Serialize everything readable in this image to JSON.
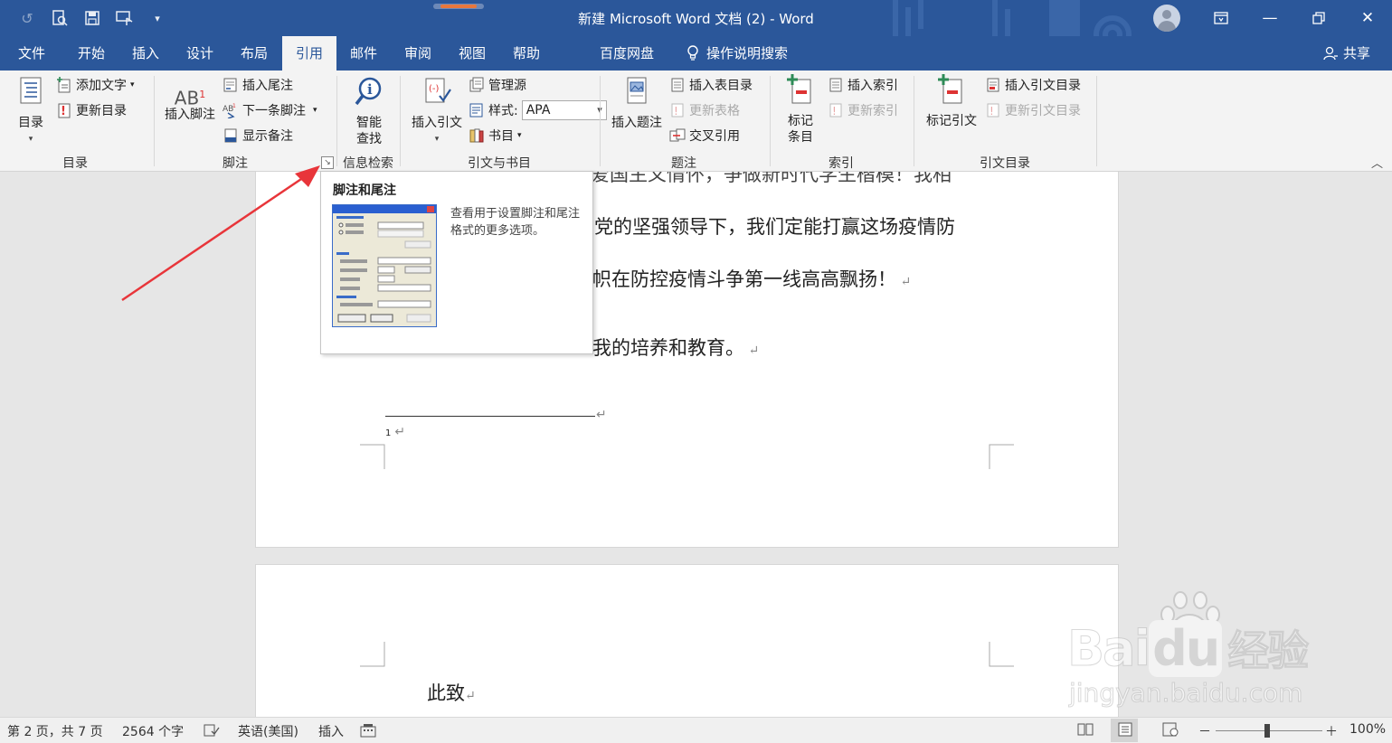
{
  "titlebar": {
    "title": "新建 Microsoft Word 文档 (2)  -  Word"
  },
  "tabs": [
    {
      "label": "文件"
    },
    {
      "label": "开始"
    },
    {
      "label": "插入"
    },
    {
      "label": "设计"
    },
    {
      "label": "布局"
    },
    {
      "label": "引用",
      "active": true
    },
    {
      "label": "邮件"
    },
    {
      "label": "审阅"
    },
    {
      "label": "视图"
    },
    {
      "label": "帮助"
    },
    {
      "label": "百度网盘"
    },
    {
      "label": "操作说明搜索"
    }
  ],
  "share_label": "共享",
  "ribbon": {
    "toc": {
      "big_label": "目录",
      "add_text": "添加文字",
      "update_toc": "更新目录",
      "group": "目录"
    },
    "footnotes": {
      "insert_footnote": "插入脚注",
      "insert_endnote": "插入尾注",
      "next_footnote": "下一条脚注",
      "show_notes": "显示备注",
      "group": "脚注"
    },
    "research": {
      "smart_lookup_1": "智能",
      "smart_lookup_2": "查找",
      "group": "信息检索"
    },
    "citations": {
      "insert_citation": "插入引文",
      "manage_sources": "管理源",
      "style_label": "样式:",
      "style_value": "APA",
      "bibliography": "书目",
      "group": "引文与书目"
    },
    "captions": {
      "insert_caption": "插入题注",
      "insert_tof": "插入表目录",
      "update_table": "更新表格",
      "cross_ref": "交叉引用",
      "group": "题注"
    },
    "index": {
      "mark_entry_1": "标记",
      "mark_entry_2": "条目",
      "insert_index": "插入索引",
      "update_index": "更新索引",
      "group": "索引"
    },
    "toa": {
      "mark_citation": "标记引文",
      "insert_toa": "插入引文目录",
      "update_toa": "更新引文目录",
      "group": "引文目录"
    }
  },
  "tooltip": {
    "title": "脚注和尾注",
    "description": "查看用于设置脚注和尾注格式的更多选项。"
  },
  "document": {
    "line1": "爱国主义情怀，争做新时代学生楷模！我相",
    "line2": "党的坚强领导下，我们定能打赢这场疫情防",
    "line3": "帜在防控疫情斗争第一线高高飘扬！",
    "line4": "我的培养和教育。",
    "footnote_number": "1",
    "page2_text": "此致"
  },
  "statusbar": {
    "page": "第 2 页，共 7 页",
    "words": "2564 个字",
    "language": "英语(美国)",
    "mode": "插入",
    "zoom": "100%",
    "zoom_minus": "－",
    "zoom_plus": "＋"
  },
  "watermark": {
    "brand": "Bai",
    "brand2": "du",
    "brand_cn": "经验",
    "url": "jingyan.baidu.com"
  },
  "colors": {
    "title_bar": "#2b579a",
    "ribbon": "#f3f3f3",
    "arrow": "#e8353a"
  }
}
